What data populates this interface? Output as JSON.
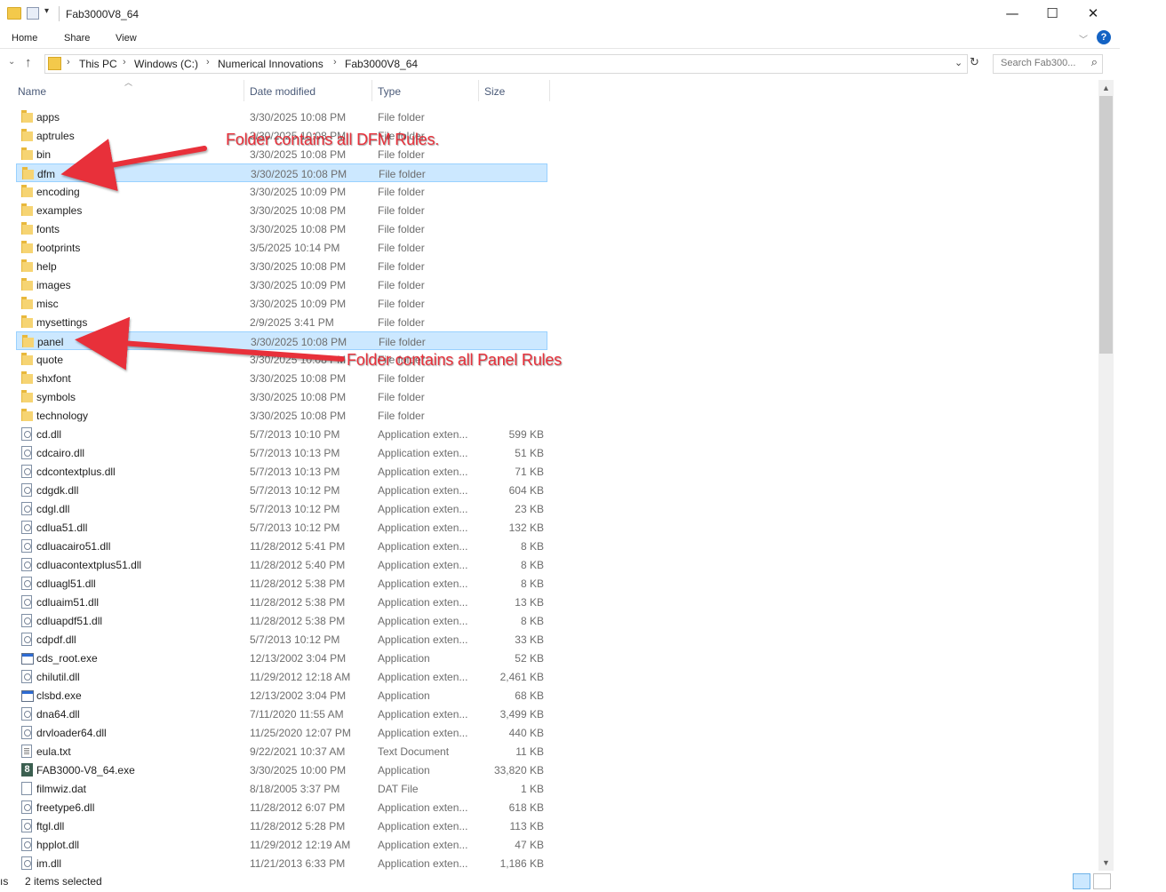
{
  "window": {
    "title": "Fab3000V8_64",
    "controls": {
      "minimize": "—",
      "maximize": "☐",
      "close": "✕"
    }
  },
  "ribbon": {
    "tabs": [
      "Home",
      "Share",
      "View"
    ],
    "help": "?"
  },
  "address": {
    "crumbs": [
      "This PC",
      "Windows (C:)",
      "Numerical Innovations",
      "Fab3000V8_64"
    ],
    "search_placeholder": "Search Fab300..."
  },
  "columns": {
    "name": "Name",
    "date": "Date modified",
    "type": "Type",
    "size": "Size"
  },
  "rows": [
    {
      "name": "apps",
      "date": "3/30/2025 10:08 PM",
      "type": "File folder",
      "size": "",
      "icon": "folder"
    },
    {
      "name": "aptrules",
      "date": "3/30/2025 10:08 PM",
      "type": "File folder",
      "size": "",
      "icon": "folder"
    },
    {
      "name": "bin",
      "date": "3/30/2025 10:08 PM",
      "type": "File folder",
      "size": "",
      "icon": "folder"
    },
    {
      "name": "dfm",
      "date": "3/30/2025 10:08 PM",
      "type": "File folder",
      "size": "",
      "icon": "folder",
      "selected": true
    },
    {
      "name": "encoding",
      "date": "3/30/2025 10:09 PM",
      "type": "File folder",
      "size": "",
      "icon": "folder"
    },
    {
      "name": "examples",
      "date": "3/30/2025 10:08 PM",
      "type": "File folder",
      "size": "",
      "icon": "folder"
    },
    {
      "name": "fonts",
      "date": "3/30/2025 10:08 PM",
      "type": "File folder",
      "size": "",
      "icon": "folder"
    },
    {
      "name": "footprints",
      "date": "3/5/2025 10:14 PM",
      "type": "File folder",
      "size": "",
      "icon": "folder"
    },
    {
      "name": "help",
      "date": "3/30/2025 10:08 PM",
      "type": "File folder",
      "size": "",
      "icon": "folder"
    },
    {
      "name": "images",
      "date": "3/30/2025 10:09 PM",
      "type": "File folder",
      "size": "",
      "icon": "folder"
    },
    {
      "name": "misc",
      "date": "3/30/2025 10:09 PM",
      "type": "File folder",
      "size": "",
      "icon": "folder"
    },
    {
      "name": "mysettings",
      "date": "2/9/2025 3:41 PM",
      "type": "File folder",
      "size": "",
      "icon": "folder"
    },
    {
      "name": "panel",
      "date": "3/30/2025 10:08 PM",
      "type": "File folder",
      "size": "",
      "icon": "folder",
      "selected": true
    },
    {
      "name": "quote",
      "date": "3/30/2025 10:08 PM",
      "type": "File folder",
      "size": "",
      "icon": "folder"
    },
    {
      "name": "shxfont",
      "date": "3/30/2025 10:08 PM",
      "type": "File folder",
      "size": "",
      "icon": "folder"
    },
    {
      "name": "symbols",
      "date": "3/30/2025 10:08 PM",
      "type": "File folder",
      "size": "",
      "icon": "folder"
    },
    {
      "name": "technology",
      "date": "3/30/2025 10:08 PM",
      "type": "File folder",
      "size": "",
      "icon": "folder"
    },
    {
      "name": "cd.dll",
      "date": "5/7/2013 10:10 PM",
      "type": "Application exten...",
      "size": "599 KB",
      "icon": "dll"
    },
    {
      "name": "cdcairo.dll",
      "date": "5/7/2013 10:13 PM",
      "type": "Application exten...",
      "size": "51 KB",
      "icon": "dll"
    },
    {
      "name": "cdcontextplus.dll",
      "date": "5/7/2013 10:13 PM",
      "type": "Application exten...",
      "size": "71 KB",
      "icon": "dll"
    },
    {
      "name": "cdgdk.dll",
      "date": "5/7/2013 10:12 PM",
      "type": "Application exten...",
      "size": "604 KB",
      "icon": "dll"
    },
    {
      "name": "cdgl.dll",
      "date": "5/7/2013 10:12 PM",
      "type": "Application exten...",
      "size": "23 KB",
      "icon": "dll"
    },
    {
      "name": "cdlua51.dll",
      "date": "5/7/2013 10:12 PM",
      "type": "Application exten...",
      "size": "132 KB",
      "icon": "dll"
    },
    {
      "name": "cdluacairo51.dll",
      "date": "11/28/2012 5:41 PM",
      "type": "Application exten...",
      "size": "8 KB",
      "icon": "dll"
    },
    {
      "name": "cdluacontextplus51.dll",
      "date": "11/28/2012 5:40 PM",
      "type": "Application exten...",
      "size": "8 KB",
      "icon": "dll"
    },
    {
      "name": "cdluagl51.dll",
      "date": "11/28/2012 5:38 PM",
      "type": "Application exten...",
      "size": "8 KB",
      "icon": "dll"
    },
    {
      "name": "cdluaim51.dll",
      "date": "11/28/2012 5:38 PM",
      "type": "Application exten...",
      "size": "13 KB",
      "icon": "dll"
    },
    {
      "name": "cdluapdf51.dll",
      "date": "11/28/2012 5:38 PM",
      "type": "Application exten...",
      "size": "8 KB",
      "icon": "dll"
    },
    {
      "name": "cdpdf.dll",
      "date": "5/7/2013 10:12 PM",
      "type": "Application exten...",
      "size": "33 KB",
      "icon": "dll"
    },
    {
      "name": "cds_root.exe",
      "date": "12/13/2002 3:04 PM",
      "type": "Application",
      "size": "52 KB",
      "icon": "exe"
    },
    {
      "name": "chilutil.dll",
      "date": "11/29/2012 12:18 AM",
      "type": "Application exten...",
      "size": "2,461 KB",
      "icon": "dll"
    },
    {
      "name": "clsbd.exe",
      "date": "12/13/2002 3:04 PM",
      "type": "Application",
      "size": "68 KB",
      "icon": "exe"
    },
    {
      "name": "dna64.dll",
      "date": "7/11/2020 11:55 AM",
      "type": "Application exten...",
      "size": "3,499 KB",
      "icon": "dll"
    },
    {
      "name": "drvloader64.dll",
      "date": "11/25/2020 12:07 PM",
      "type": "Application exten...",
      "size": "440 KB",
      "icon": "dll"
    },
    {
      "name": "eula.txt",
      "date": "9/22/2021 10:37 AM",
      "type": "Text Document",
      "size": "11 KB",
      "icon": "txt"
    },
    {
      "name": "FAB3000-V8_64.exe",
      "date": "3/30/2025 10:00 PM",
      "type": "Application",
      "size": "33,820 KB",
      "icon": "exe8"
    },
    {
      "name": "filmwiz.dat",
      "date": "8/18/2005 3:37 PM",
      "type": "DAT File",
      "size": "1 KB",
      "icon": "dat"
    },
    {
      "name": "freetype6.dll",
      "date": "11/28/2012 6:07 PM",
      "type": "Application exten...",
      "size": "618 KB",
      "icon": "dll"
    },
    {
      "name": "ftgl.dll",
      "date": "11/28/2012 5:28 PM",
      "type": "Application exten...",
      "size": "113 KB",
      "icon": "dll"
    },
    {
      "name": "hpplot.dll",
      "date": "11/29/2012 12:19 AM",
      "type": "Application exten...",
      "size": "47 KB",
      "icon": "dll"
    },
    {
      "name": "im.dll",
      "date": "11/21/2013 6:33 PM",
      "type": "Application exten...",
      "size": "1,186 KB",
      "icon": "dll"
    }
  ],
  "status": {
    "left_fragment": "ıs",
    "selection": "2 items selected"
  },
  "annotations": {
    "dfm_note": "Folder contains all DFM Rules.",
    "panel_note": "Folder contains all Panel Rules",
    "arrow_color": "#e8303a"
  },
  "colors": {
    "selection_bg": "#cce8ff",
    "selection_border": "#99d1ff",
    "accent": "#1463c4"
  }
}
